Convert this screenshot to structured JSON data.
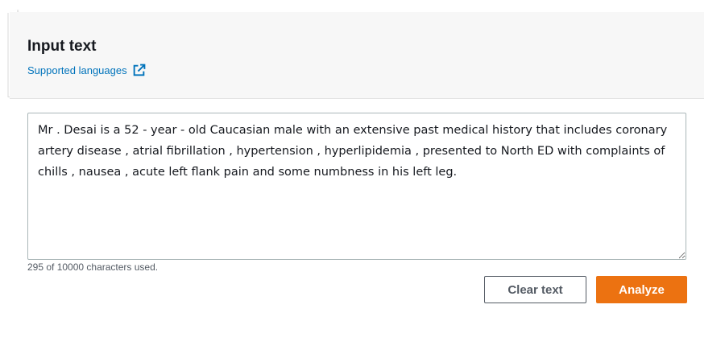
{
  "input_panel": {
    "title": "Input text",
    "supported_languages_link": "Supported languages",
    "textarea_value": "Mr . Desai is a 52 - year - old Caucasian male with an extensive past medical history that includes coronary artery disease , atrial fibrillation , hypertension , hyperlipidemia , presented to North ED with complaints of chills , nausea , acute left flank pain and some numbness in his left leg.",
    "char_count": "295 of 10000 characters used.",
    "clear_button": "Clear text",
    "analyze_button": "Analyze"
  },
  "icons": {
    "link": "external-link-icon"
  },
  "colors": {
    "link": "#0073bb",
    "primary_button": "#ec7211",
    "header_background": "#f7f7f7"
  }
}
